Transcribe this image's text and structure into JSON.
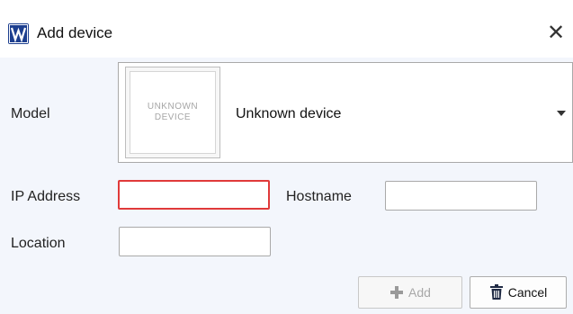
{
  "window": {
    "title": "Add device",
    "close_glyph": "✕"
  },
  "app_icon": {
    "name": "app-logo-icon",
    "color": "#1d3f8f"
  },
  "form": {
    "model_label": "Model",
    "model_value": "Unknown device",
    "model_image_text_line1": "UNKNOWN",
    "model_image_text_line2": "DEVICE",
    "ip_label": "IP Address",
    "ip_value": "",
    "hostname_label": "Hostname",
    "hostname_value": "",
    "location_label": "Location",
    "location_value": ""
  },
  "buttons": {
    "add_label": "Add",
    "add_enabled": false,
    "add_icon": "plus-icon",
    "cancel_label": "Cancel",
    "cancel_icon": "trash-icon"
  },
  "colors": {
    "content_background": "#f3f6fc",
    "invalid_border": "#e03a3a",
    "add_icon_color": "#9a9a9a",
    "cancel_icon_color": "#1f2a44"
  }
}
